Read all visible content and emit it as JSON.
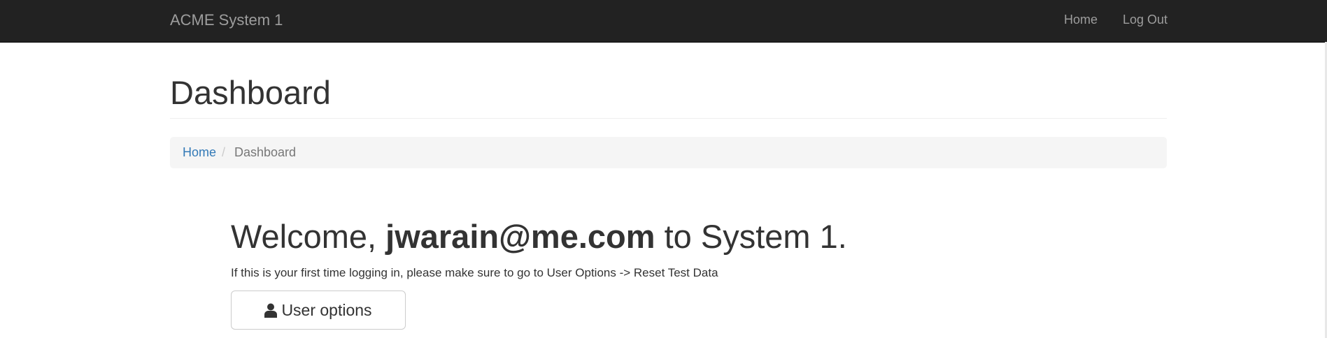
{
  "navbar": {
    "brand": "ACME System 1",
    "links": [
      {
        "label": "Home"
      },
      {
        "label": "Log Out"
      }
    ]
  },
  "page": {
    "title": "Dashboard"
  },
  "breadcrumb": {
    "items": [
      {
        "label": "Home",
        "link": true
      },
      {
        "label": "Dashboard",
        "link": false
      }
    ],
    "separator": "/"
  },
  "welcome": {
    "prefix": "Welcome, ",
    "user": "jwarain@me.com",
    "suffix": " to System 1.",
    "hint": "If this is your first time logging in, please make sure to go to User Options -> Reset Test Data"
  },
  "actions": {
    "user_options_label": "User options",
    "user_options_icon": "user-icon"
  },
  "colors": {
    "navbar_bg": "#222222",
    "navbar_text": "#9d9d9d",
    "link": "#337ab7",
    "breadcrumb_bg": "#f5f5f5",
    "text": "#333333"
  }
}
